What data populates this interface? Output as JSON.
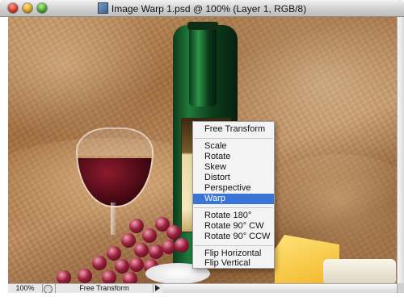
{
  "window": {
    "title": "Image Warp 1.psd @ 100% (Layer 1, RGB/8)",
    "icons": {
      "close": "close-button",
      "minimize": "minimize-button",
      "zoom": "zoom-button",
      "doc": "document-icon"
    }
  },
  "context_menu": {
    "items": [
      {
        "label": "Free Transform"
      },
      {
        "label": "Scale"
      },
      {
        "label": "Rotate"
      },
      {
        "label": "Skew"
      },
      {
        "label": "Distort"
      },
      {
        "label": "Perspective"
      },
      {
        "label": "Warp",
        "selected": true
      },
      {
        "label": "Rotate 180°"
      },
      {
        "label": "Rotate 90° CW"
      },
      {
        "label": "Rotate 90° CCW"
      },
      {
        "label": "Flip Horizontal"
      },
      {
        "label": "Flip Vertical"
      }
    ],
    "selected_color": "#3875d7"
  },
  "status_bar": {
    "zoom": "100%",
    "info": "Free Transform"
  }
}
